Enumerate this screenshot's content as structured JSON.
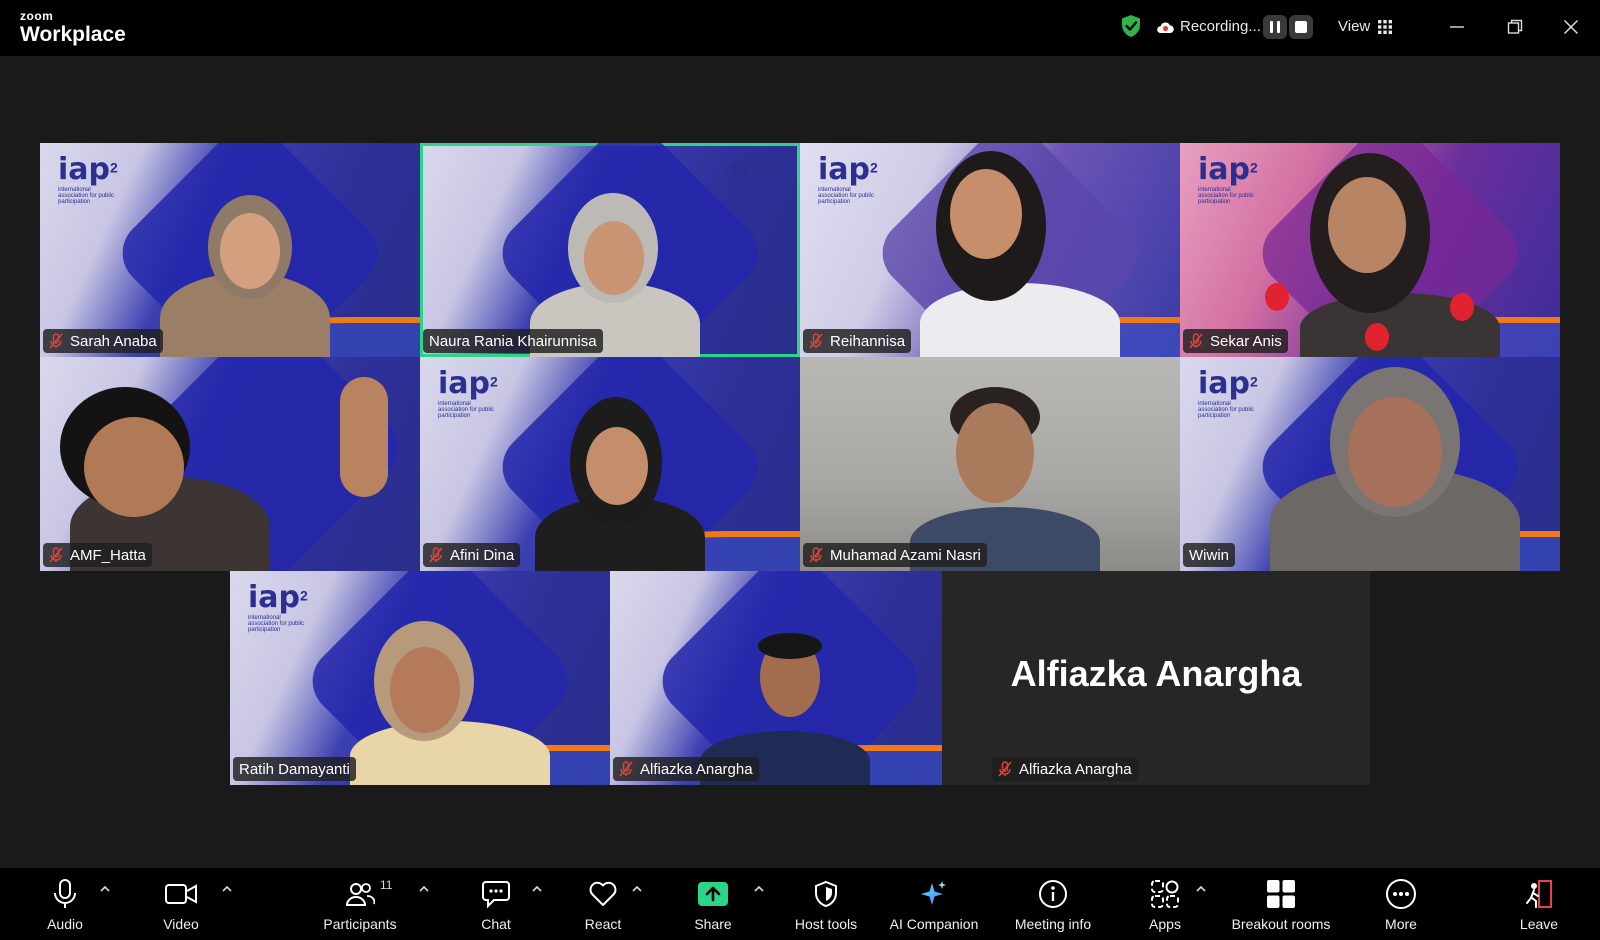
{
  "app": {
    "brand_top": "zoom",
    "brand_main": "Workplace"
  },
  "titlebar": {
    "recording_label": "Recording...",
    "view_label": "View"
  },
  "participants": [
    {
      "name": "Sarah Anaba",
      "muted": true,
      "background": "iap"
    },
    {
      "name": "Naura Rania Khairunnisa",
      "muted": false,
      "background": "iap",
      "active_speaker": true
    },
    {
      "name": "Reihannisa",
      "muted": true,
      "background": "violet"
    },
    {
      "name": "Sekar Anis",
      "muted": true,
      "background": "pink"
    },
    {
      "name": "AMF_Hatta",
      "muted": true,
      "background": "iap"
    },
    {
      "name": "Afini Dina",
      "muted": true,
      "background": "iap"
    },
    {
      "name": "Muhamad Azami Nasri",
      "muted": true,
      "background": "wall"
    },
    {
      "name": "Wiwin",
      "muted": false,
      "background": "iap"
    },
    {
      "name": "Ratih Damayanti",
      "muted": false,
      "background": "iap"
    },
    {
      "name": "Alfiazka Anargha",
      "muted": true,
      "background": "iap"
    },
    {
      "name": "Alfiazka Anargha",
      "muted": true,
      "background": "none",
      "display_name": "Alfiazka Anargha"
    }
  ],
  "logos": {
    "iap": "iap",
    "iap_sup": "2",
    "iap_sub": "international association for public participation"
  },
  "toolbar": {
    "audio": "Audio",
    "video": "Video",
    "participants": "Participants",
    "participant_count": "11",
    "chat": "Chat",
    "react": "React",
    "share": "Share",
    "host_tools": "Host tools",
    "ai_companion": "AI Companion",
    "meeting_info": "Meeting info",
    "apps": "Apps",
    "breakout_rooms": "Breakout rooms",
    "more": "More",
    "leave": "Leave"
  },
  "colors": {
    "active_speaker": "#2ad58a",
    "share_green": "#2ad58a",
    "mute_red": "#e0413a",
    "shield_green": "#2fb34a",
    "leave_red": "#e8434b"
  }
}
